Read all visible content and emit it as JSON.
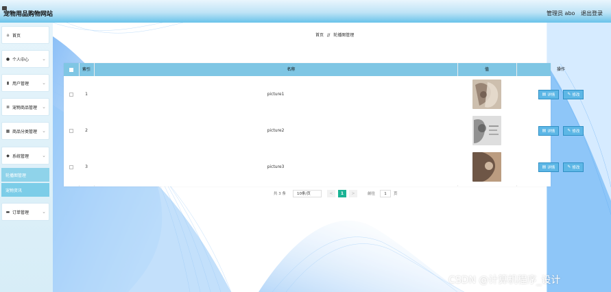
{
  "app": {
    "title": "宠物用品购物网站"
  },
  "header": {
    "user": "管理员 abo",
    "logout": "退出登录"
  },
  "sidebar": {
    "items": [
      {
        "icon": "home-icon",
        "glyph": "⌂",
        "label": "首页",
        "chevron": ""
      },
      {
        "icon": "user-icon",
        "glyph": "●",
        "label": "个人中心",
        "chevron": "⌄"
      },
      {
        "icon": "chart-bar-icon",
        "glyph": "▮",
        "label": "用户管理",
        "chevron": "⌄"
      },
      {
        "icon": "list-icon",
        "glyph": "≣",
        "label": "宠物商品管理",
        "chevron": "⌄"
      },
      {
        "icon": "grid-icon",
        "glyph": "▦",
        "label": "商品分类管理",
        "chevron": "⌄"
      },
      {
        "icon": "shield-icon",
        "glyph": "◆",
        "label": "系统管理",
        "chevron": "⌄"
      },
      {
        "icon": "chat-icon",
        "glyph": "▬",
        "label": "订单管理",
        "chevron": "⌄"
      }
    ],
    "sub_items": [
      {
        "label": "轮播图管理"
      },
      {
        "label": "宠物资讯"
      }
    ]
  },
  "breadcrumb": {
    "home": "首页",
    "separator": "//",
    "current": "轮播图管理"
  },
  "table": {
    "columns": [
      "索引",
      "名称",
      "值",
      "操作"
    ],
    "rows": [
      {
        "index": "1",
        "name": "picture1",
        "thumb_colors": [
          "#c9b9a6",
          "#8d7a6a"
        ]
      },
      {
        "index": "2",
        "name": "picture2",
        "thumb_colors": [
          "#d8d8d8",
          "#8a8a8a"
        ]
      },
      {
        "index": "3",
        "name": "picture3",
        "thumb_colors": [
          "#b89a80",
          "#6b5444"
        ]
      }
    ],
    "actions": {
      "detail": "详情",
      "edit": "修改"
    }
  },
  "pagination": {
    "total": "共 3 条",
    "page_size": "10条/页",
    "prev": "<",
    "current_page": "1",
    "next": ">",
    "goto_label": "前往",
    "goto_value": "1",
    "page_suffix": "页"
  },
  "watermark": "CSDN @计算机程序_设计",
  "colors": {
    "header_bar": "#7fc6e4",
    "button": "#5db7e6",
    "pager_current": "#1ab394",
    "submenu": "#7ccde8"
  }
}
